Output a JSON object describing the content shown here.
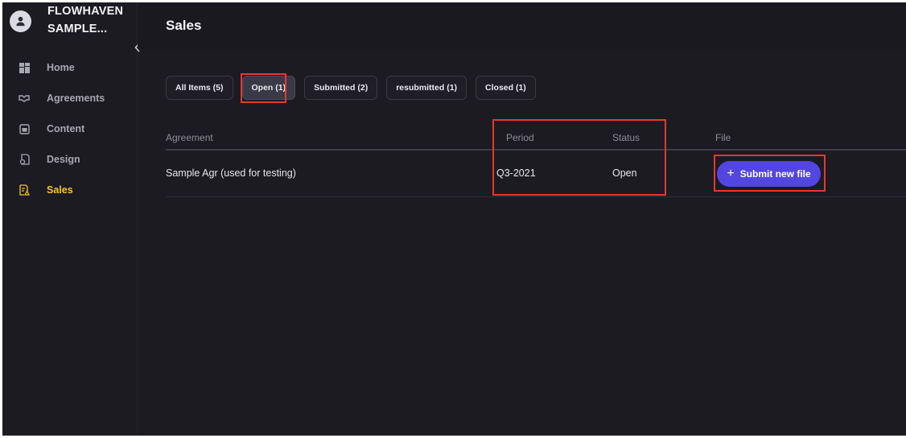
{
  "org": {
    "name_line1": "FLOWHAVEN",
    "name_line2": "SAMPLE..."
  },
  "sidebar": {
    "items": [
      {
        "label": "Home",
        "icon": "dashboard-icon",
        "active": false
      },
      {
        "label": "Agreements",
        "icon": "handshake-icon",
        "active": false
      },
      {
        "label": "Content",
        "icon": "gallery-icon",
        "active": false
      },
      {
        "label": "Design",
        "icon": "design-file-icon",
        "active": false
      },
      {
        "label": "Sales",
        "icon": "sales-report-icon",
        "active": true
      }
    ]
  },
  "header": {
    "title": "Sales"
  },
  "filters": [
    {
      "label": "All Items (5)",
      "active": false
    },
    {
      "label": "Open (1)",
      "active": true
    },
    {
      "label": "Submitted (2)",
      "active": false
    },
    {
      "label": "resubmitted (1)",
      "active": false
    },
    {
      "label": "Closed (1)",
      "active": false
    }
  ],
  "table": {
    "columns": [
      "Agreement",
      "Period",
      "Status",
      "File"
    ],
    "rows": [
      {
        "agreement": "Sample Agr (used for testing)",
        "period": "Q3-2021",
        "status": "Open",
        "file_action": "Submit new file"
      }
    ]
  },
  "colors": {
    "background": "#1c1b22",
    "accent": "#5245e0",
    "active_nav": "#f5c431",
    "highlight": "#e33a2c"
  }
}
